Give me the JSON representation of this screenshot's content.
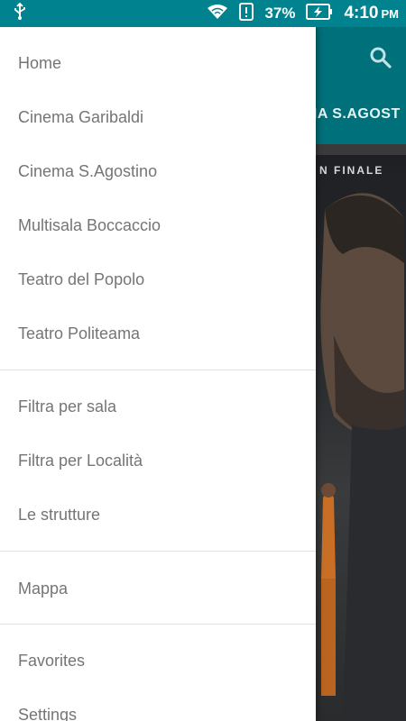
{
  "status_bar": {
    "battery": "37%",
    "time": "4:10",
    "ampm": "PM",
    "icons": [
      "usb-icon",
      "wifi-icon",
      "alert-icon",
      "battery-charging-icon"
    ]
  },
  "background_app": {
    "tab_label": "MA S.AGOST",
    "poster_banner": "N FINALE",
    "toolbar_icon": "search-icon"
  },
  "drawer": {
    "group1": [
      "Home",
      "Cinema Garibaldi",
      "Cinema S.Agostino",
      "Multisala Boccaccio",
      "Teatro del Popolo",
      "Teatro Politeama"
    ],
    "group2": [
      "Filtra per sala",
      "Filtra per Località",
      "Le strutture"
    ],
    "group3": [
      "Mappa"
    ],
    "group4": [
      "Favorites",
      "Settings"
    ]
  },
  "colors": {
    "status_bar": "#00838f",
    "toolbar": "#00707a",
    "menu_text": "#757575",
    "divider": "#e0e0e0"
  }
}
